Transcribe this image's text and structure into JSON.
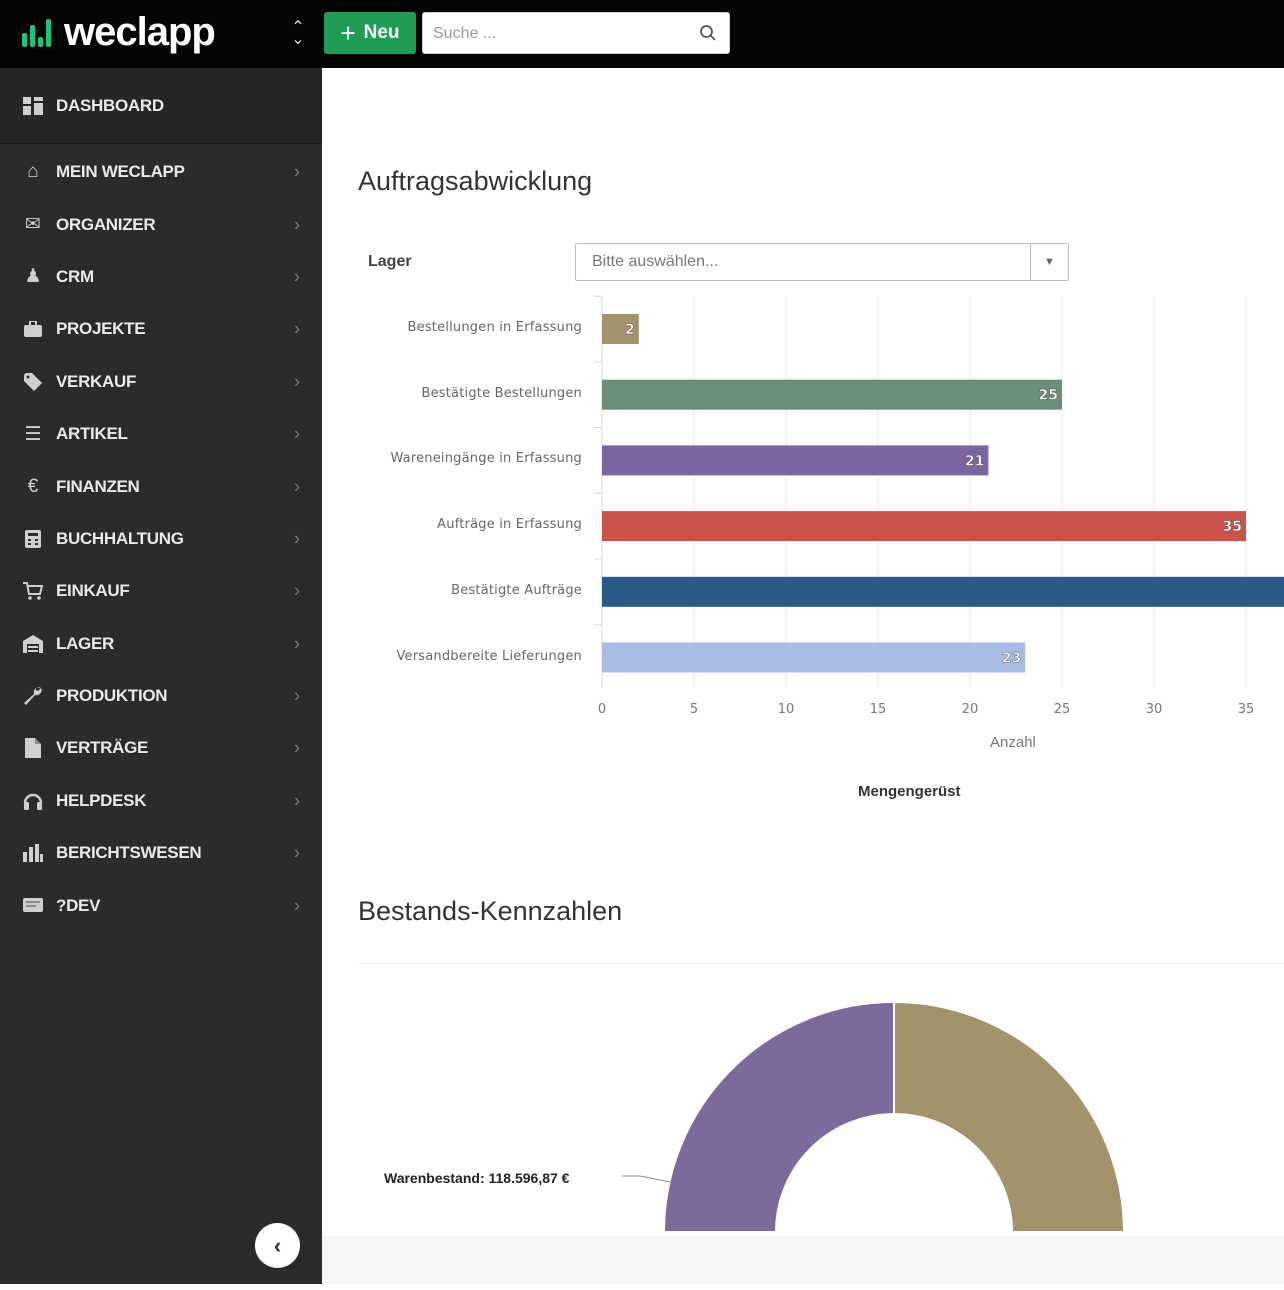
{
  "app": {
    "logo_text": "weclapp",
    "new_button_label": "Neu",
    "search_placeholder": "Suche ..."
  },
  "sidebar": {
    "dashboard": {
      "label": "DASHBOARD",
      "icon": "dashboard-icon"
    },
    "items": [
      {
        "label": "MEIN WECLAPP",
        "icon": "home-icon"
      },
      {
        "label": "ORGANIZER",
        "icon": "envelope-icon"
      },
      {
        "label": "CRM",
        "icon": "contacts-icon"
      },
      {
        "label": "PROJEKTE",
        "icon": "briefcase-icon"
      },
      {
        "label": "VERKAUF",
        "icon": "tag-icon"
      },
      {
        "label": "ARTIKEL",
        "icon": "list-icon"
      },
      {
        "label": "FINANZEN",
        "icon": "euro-icon"
      },
      {
        "label": "BUCHHALTUNG",
        "icon": "calculator-icon"
      },
      {
        "label": "EINKAUF",
        "icon": "cart-icon"
      },
      {
        "label": "LAGER",
        "icon": "warehouse-icon"
      },
      {
        "label": "PRODUKTION",
        "icon": "wrench-icon"
      },
      {
        "label": "VERTRÄGE",
        "icon": "document-icon"
      },
      {
        "label": "HELPDESK",
        "icon": "headset-icon"
      },
      {
        "label": "BERICHTSWESEN",
        "icon": "bar-chart-icon"
      },
      {
        "label": "?DEV",
        "icon": "dev-icon"
      }
    ]
  },
  "main": {
    "section1_title": "Auftragsabwicklung",
    "lager_label": "Lager",
    "lager_select_value": "Bitte auswählen...",
    "section2_title": "Bestands-Kennzahlen",
    "gauge_label": "Warenbestand: 118.596,87 €"
  },
  "chart_data": [
    {
      "type": "bar",
      "orientation": "horizontal",
      "categories": [
        "Bestellungen in Erfassung",
        "Bestätigte Bestellungen",
        "Wareneingänge in Erfassung",
        "Aufträge in Erfassung",
        "Bestätigte Aufträge",
        "Versandbereite Lieferungen"
      ],
      "values": [
        2,
        25,
        21,
        35,
        40,
        23
      ],
      "data_labels": [
        "2",
        "25",
        "21",
        "35",
        "",
        "23"
      ],
      "colors": [
        "#a3936a",
        "#6b8f7a",
        "#7b64a0",
        "#c9544a",
        "#2b5a86",
        "#a9bce6"
      ],
      "xlabel": "Anzahl",
      "caption": "Mengengerüst",
      "xticks": [
        0,
        5,
        10,
        15,
        20,
        25,
        30,
        35
      ],
      "xlim": [
        0,
        37
      ],
      "grid": true
    },
    {
      "type": "pie",
      "variant": "semi-donut",
      "slices": [
        {
          "label": "Warenbestand: 118.596,87 €",
          "value": 118596.87,
          "color": "#7d6a9c"
        },
        {
          "value": 118596.87,
          "color": "#a3936a"
        }
      ]
    }
  ]
}
